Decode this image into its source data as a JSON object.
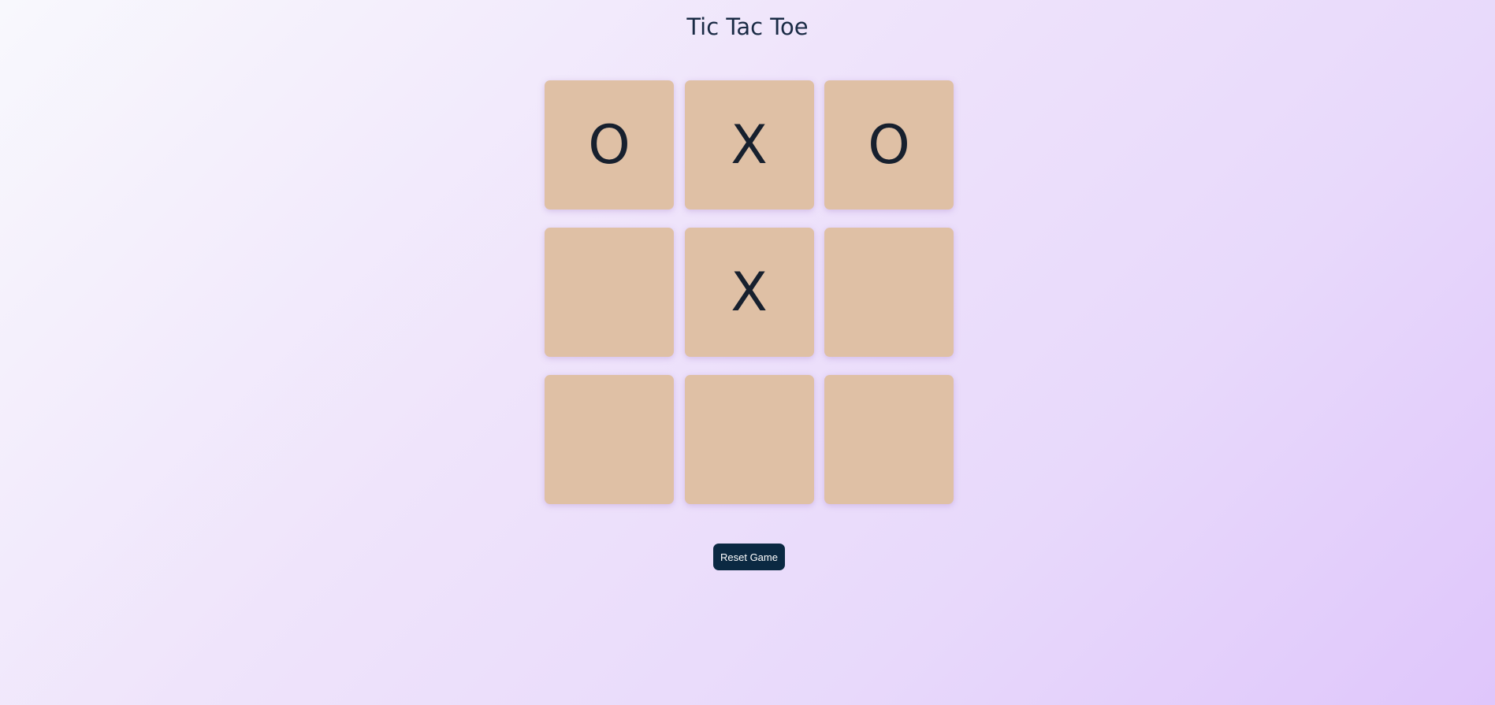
{
  "title": "Tic Tac Toe",
  "board": {
    "cells": [
      "O",
      "X",
      "O",
      "",
      "X",
      "",
      "",
      "",
      ""
    ]
  },
  "reset_label": "Reset Game",
  "colors": {
    "cell_background": "#dfc0a5",
    "mark": "#17202e",
    "button": "#0b2942",
    "title": "#1a2b45"
  }
}
